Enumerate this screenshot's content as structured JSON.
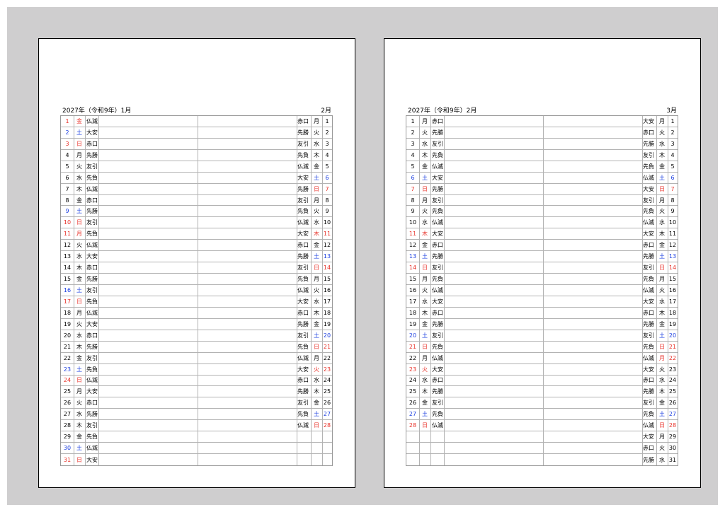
{
  "pages": [
    {
      "left_title": "2027年（令和9年）1月",
      "right_title": "2月",
      "left_rows": [
        {
          "day": "1",
          "wd": "金",
          "rk": "仏滅",
          "c": "red"
        },
        {
          "day": "2",
          "wd": "土",
          "rk": "大安",
          "c": "blue"
        },
        {
          "day": "3",
          "wd": "日",
          "rk": "赤口",
          "c": "red"
        },
        {
          "day": "4",
          "wd": "月",
          "rk": "先勝",
          "c": ""
        },
        {
          "day": "5",
          "wd": "火",
          "rk": "友引",
          "c": ""
        },
        {
          "day": "6",
          "wd": "水",
          "rk": "先負",
          "c": ""
        },
        {
          "day": "7",
          "wd": "木",
          "rk": "仏滅",
          "c": ""
        },
        {
          "day": "8",
          "wd": "金",
          "rk": "赤口",
          "c": ""
        },
        {
          "day": "9",
          "wd": "土",
          "rk": "先勝",
          "c": "blue"
        },
        {
          "day": "10",
          "wd": "日",
          "rk": "友引",
          "c": "red"
        },
        {
          "day": "11",
          "wd": "月",
          "rk": "先負",
          "c": "red"
        },
        {
          "day": "12",
          "wd": "火",
          "rk": "仏滅",
          "c": ""
        },
        {
          "day": "13",
          "wd": "水",
          "rk": "大安",
          "c": ""
        },
        {
          "day": "14",
          "wd": "木",
          "rk": "赤口",
          "c": ""
        },
        {
          "day": "15",
          "wd": "金",
          "rk": "先勝",
          "c": ""
        },
        {
          "day": "16",
          "wd": "土",
          "rk": "友引",
          "c": "blue"
        },
        {
          "day": "17",
          "wd": "日",
          "rk": "先負",
          "c": "red"
        },
        {
          "day": "18",
          "wd": "月",
          "rk": "仏滅",
          "c": ""
        },
        {
          "day": "19",
          "wd": "火",
          "rk": "大安",
          "c": ""
        },
        {
          "day": "20",
          "wd": "水",
          "rk": "赤口",
          "c": ""
        },
        {
          "day": "21",
          "wd": "木",
          "rk": "先勝",
          "c": ""
        },
        {
          "day": "22",
          "wd": "金",
          "rk": "友引",
          "c": ""
        },
        {
          "day": "23",
          "wd": "土",
          "rk": "先負",
          "c": "blue"
        },
        {
          "day": "24",
          "wd": "日",
          "rk": "仏滅",
          "c": "red"
        },
        {
          "day": "25",
          "wd": "月",
          "rk": "大安",
          "c": ""
        },
        {
          "day": "26",
          "wd": "火",
          "rk": "赤口",
          "c": ""
        },
        {
          "day": "27",
          "wd": "水",
          "rk": "先勝",
          "c": ""
        },
        {
          "day": "28",
          "wd": "木",
          "rk": "友引",
          "c": ""
        },
        {
          "day": "29",
          "wd": "金",
          "rk": "先負",
          "c": ""
        },
        {
          "day": "30",
          "wd": "土",
          "rk": "仏滅",
          "c": "blue"
        },
        {
          "day": "31",
          "wd": "日",
          "rk": "大安",
          "c": "red"
        }
      ],
      "right_rows": [
        {
          "rk": "赤口",
          "wd": "月",
          "day": "1",
          "c": ""
        },
        {
          "rk": "先勝",
          "wd": "火",
          "day": "2",
          "c": ""
        },
        {
          "rk": "友引",
          "wd": "水",
          "day": "3",
          "c": ""
        },
        {
          "rk": "先負",
          "wd": "木",
          "day": "4",
          "c": ""
        },
        {
          "rk": "仏滅",
          "wd": "金",
          "day": "5",
          "c": ""
        },
        {
          "rk": "大安",
          "wd": "土",
          "day": "6",
          "c": "blue"
        },
        {
          "rk": "先勝",
          "wd": "日",
          "day": "7",
          "c": "red"
        },
        {
          "rk": "友引",
          "wd": "月",
          "day": "8",
          "c": ""
        },
        {
          "rk": "先負",
          "wd": "火",
          "day": "9",
          "c": ""
        },
        {
          "rk": "仏滅",
          "wd": "水",
          "day": "10",
          "c": ""
        },
        {
          "rk": "大安",
          "wd": "木",
          "day": "11",
          "c": "red"
        },
        {
          "rk": "赤口",
          "wd": "金",
          "day": "12",
          "c": ""
        },
        {
          "rk": "先勝",
          "wd": "土",
          "day": "13",
          "c": "blue"
        },
        {
          "rk": "友引",
          "wd": "日",
          "day": "14",
          "c": "red"
        },
        {
          "rk": "先負",
          "wd": "月",
          "day": "15",
          "c": ""
        },
        {
          "rk": "仏滅",
          "wd": "火",
          "day": "16",
          "c": ""
        },
        {
          "rk": "大安",
          "wd": "水",
          "day": "17",
          "c": ""
        },
        {
          "rk": "赤口",
          "wd": "木",
          "day": "18",
          "c": ""
        },
        {
          "rk": "先勝",
          "wd": "金",
          "day": "19",
          "c": ""
        },
        {
          "rk": "友引",
          "wd": "土",
          "day": "20",
          "c": "blue"
        },
        {
          "rk": "先負",
          "wd": "日",
          "day": "21",
          "c": "red"
        },
        {
          "rk": "仏滅",
          "wd": "月",
          "day": "22",
          "c": ""
        },
        {
          "rk": "大安",
          "wd": "火",
          "day": "23",
          "c": "red"
        },
        {
          "rk": "赤口",
          "wd": "水",
          "day": "24",
          "c": ""
        },
        {
          "rk": "先勝",
          "wd": "木",
          "day": "25",
          "c": ""
        },
        {
          "rk": "友引",
          "wd": "金",
          "day": "26",
          "c": ""
        },
        {
          "rk": "先負",
          "wd": "土",
          "day": "27",
          "c": "blue"
        },
        {
          "rk": "仏滅",
          "wd": "日",
          "day": "28",
          "c": "red"
        },
        {
          "rk": "",
          "wd": "",
          "day": "",
          "c": ""
        },
        {
          "rk": "",
          "wd": "",
          "day": "",
          "c": ""
        },
        {
          "rk": "",
          "wd": "",
          "day": "",
          "c": ""
        }
      ]
    },
    {
      "left_title": "2027年（令和9年）2月",
      "right_title": "3月",
      "left_rows": [
        {
          "day": "1",
          "wd": "月",
          "rk": "赤口",
          "c": ""
        },
        {
          "day": "2",
          "wd": "火",
          "rk": "先勝",
          "c": ""
        },
        {
          "day": "3",
          "wd": "水",
          "rk": "友引",
          "c": ""
        },
        {
          "day": "4",
          "wd": "木",
          "rk": "先負",
          "c": ""
        },
        {
          "day": "5",
          "wd": "金",
          "rk": "仏滅",
          "c": ""
        },
        {
          "day": "6",
          "wd": "土",
          "rk": "大安",
          "c": "blue"
        },
        {
          "day": "7",
          "wd": "日",
          "rk": "先勝",
          "c": "red"
        },
        {
          "day": "8",
          "wd": "月",
          "rk": "友引",
          "c": ""
        },
        {
          "day": "9",
          "wd": "火",
          "rk": "先負",
          "c": ""
        },
        {
          "day": "10",
          "wd": "水",
          "rk": "仏滅",
          "c": ""
        },
        {
          "day": "11",
          "wd": "木",
          "rk": "大安",
          "c": "red"
        },
        {
          "day": "12",
          "wd": "金",
          "rk": "赤口",
          "c": ""
        },
        {
          "day": "13",
          "wd": "土",
          "rk": "先勝",
          "c": "blue"
        },
        {
          "day": "14",
          "wd": "日",
          "rk": "友引",
          "c": "red"
        },
        {
          "day": "15",
          "wd": "月",
          "rk": "先負",
          "c": ""
        },
        {
          "day": "16",
          "wd": "火",
          "rk": "仏滅",
          "c": ""
        },
        {
          "day": "17",
          "wd": "水",
          "rk": "大安",
          "c": ""
        },
        {
          "day": "18",
          "wd": "木",
          "rk": "赤口",
          "c": ""
        },
        {
          "day": "19",
          "wd": "金",
          "rk": "先勝",
          "c": ""
        },
        {
          "day": "20",
          "wd": "土",
          "rk": "友引",
          "c": "blue"
        },
        {
          "day": "21",
          "wd": "日",
          "rk": "先負",
          "c": "red"
        },
        {
          "day": "22",
          "wd": "月",
          "rk": "仏滅",
          "c": ""
        },
        {
          "day": "23",
          "wd": "火",
          "rk": "大安",
          "c": "red"
        },
        {
          "day": "24",
          "wd": "水",
          "rk": "赤口",
          "c": ""
        },
        {
          "day": "25",
          "wd": "木",
          "rk": "先勝",
          "c": ""
        },
        {
          "day": "26",
          "wd": "金",
          "rk": "友引",
          "c": ""
        },
        {
          "day": "27",
          "wd": "土",
          "rk": "先負",
          "c": "blue"
        },
        {
          "day": "28",
          "wd": "日",
          "rk": "仏滅",
          "c": "red"
        },
        {
          "day": "",
          "wd": "",
          "rk": "",
          "c": ""
        },
        {
          "day": "",
          "wd": "",
          "rk": "",
          "c": ""
        },
        {
          "day": "",
          "wd": "",
          "rk": "",
          "c": ""
        }
      ],
      "right_rows": [
        {
          "rk": "大安",
          "wd": "月",
          "day": "1",
          "c": ""
        },
        {
          "rk": "赤口",
          "wd": "火",
          "day": "2",
          "c": ""
        },
        {
          "rk": "先勝",
          "wd": "水",
          "day": "3",
          "c": ""
        },
        {
          "rk": "友引",
          "wd": "木",
          "day": "4",
          "c": ""
        },
        {
          "rk": "先負",
          "wd": "金",
          "day": "5",
          "c": ""
        },
        {
          "rk": "仏滅",
          "wd": "土",
          "day": "6",
          "c": "blue"
        },
        {
          "rk": "大安",
          "wd": "日",
          "day": "7",
          "c": "red"
        },
        {
          "rk": "友引",
          "wd": "月",
          "day": "8",
          "c": ""
        },
        {
          "rk": "先負",
          "wd": "火",
          "day": "9",
          "c": ""
        },
        {
          "rk": "仏滅",
          "wd": "水",
          "day": "10",
          "c": ""
        },
        {
          "rk": "大安",
          "wd": "木",
          "day": "11",
          "c": ""
        },
        {
          "rk": "赤口",
          "wd": "金",
          "day": "12",
          "c": ""
        },
        {
          "rk": "先勝",
          "wd": "土",
          "day": "13",
          "c": "blue"
        },
        {
          "rk": "友引",
          "wd": "日",
          "day": "14",
          "c": "red"
        },
        {
          "rk": "先負",
          "wd": "月",
          "day": "15",
          "c": ""
        },
        {
          "rk": "仏滅",
          "wd": "火",
          "day": "16",
          "c": ""
        },
        {
          "rk": "大安",
          "wd": "水",
          "day": "17",
          "c": ""
        },
        {
          "rk": "赤口",
          "wd": "木",
          "day": "18",
          "c": ""
        },
        {
          "rk": "先勝",
          "wd": "金",
          "day": "19",
          "c": ""
        },
        {
          "rk": "友引",
          "wd": "土",
          "day": "20",
          "c": "blue"
        },
        {
          "rk": "先負",
          "wd": "日",
          "day": "21",
          "c": "red"
        },
        {
          "rk": "仏滅",
          "wd": "月",
          "day": "22",
          "c": "red"
        },
        {
          "rk": "大安",
          "wd": "火",
          "day": "23",
          "c": ""
        },
        {
          "rk": "赤口",
          "wd": "水",
          "day": "24",
          "c": ""
        },
        {
          "rk": "先勝",
          "wd": "木",
          "day": "25",
          "c": ""
        },
        {
          "rk": "友引",
          "wd": "金",
          "day": "26",
          "c": ""
        },
        {
          "rk": "先負",
          "wd": "土",
          "day": "27",
          "c": "blue"
        },
        {
          "rk": "仏滅",
          "wd": "日",
          "day": "28",
          "c": "red"
        },
        {
          "rk": "大安",
          "wd": "月",
          "day": "29",
          "c": ""
        },
        {
          "rk": "赤口",
          "wd": "火",
          "day": "30",
          "c": ""
        },
        {
          "rk": "先勝",
          "wd": "水",
          "day": "31",
          "c": ""
        }
      ]
    }
  ],
  "colors": {
    "holiday_red": "#e8322a",
    "saturday_blue": "#1e40e0",
    "gridline": "#b3b3b3",
    "background": "#cfcecf"
  }
}
